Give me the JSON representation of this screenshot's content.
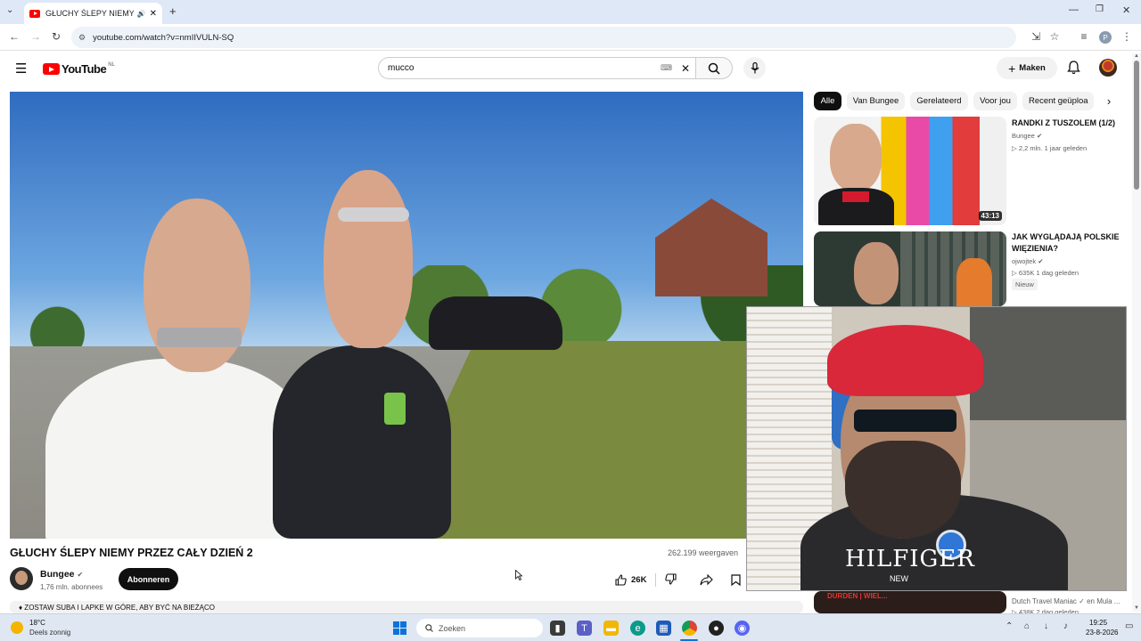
{
  "browser": {
    "tab_title": "GŁUCHY ŚLEPY NIEMY PRZEZ...",
    "url": "youtube.com/watch?v=nmIIVULN-SQ",
    "profile_initial": "P"
  },
  "masthead": {
    "logo": "YouTube",
    "region": "NL",
    "search_value": "mucco",
    "create_label": "Maken"
  },
  "video": {
    "title": "GŁUCHY ŚLEPY NIEMY PRZEZ CAŁY DZIEŃ 2",
    "views": "262.199 weergaven",
    "channel": "Bungee",
    "subscribers": "1,76 mln. abonnees",
    "subscribe_label": "Abonneren",
    "likes": "26K",
    "description_preview": "♦ ZOSTAW SUBA I LAPKE W GÓRE, ABY BYĆ NA BIEŻĄCO"
  },
  "webcam": {
    "shirt_text": "HILFIGER",
    "shirt_sub": "NEW"
  },
  "sidebar": {
    "chips": [
      "Alle",
      "Van Bungee",
      "Gerelateerd",
      "Voor jou",
      "Recent geüploa"
    ],
    "items": [
      {
        "title": "RANDKI Z TUSZOLEM (1/2)",
        "channel": "Bungee",
        "meta": "▷ 2,2 mln.   1 jaar geleden",
        "duration": "43:13"
      },
      {
        "title": "JAK WYGLĄDAJĄ POLSKIE WIĘZIENIA?",
        "channel": "ojwojtek",
        "meta": "▷ 635K   1 dag geleden",
        "badge": "Nieuw"
      },
      {
        "channel": "Dutch Travel Maniac ✓ en Mula ...",
        "meta": "▷ 438K   2 dag geleden",
        "thumb_text": "DURDEN | WIEL..."
      }
    ]
  },
  "taskbar": {
    "temp": "18°C",
    "weather": "Deels zonnig",
    "search_placeholder": "Zoeken",
    "time": "19:25",
    "date": "23-8-2026"
  },
  "colors": {
    "yt_red": "#ff0000",
    "chip_active": "#0f0f0f",
    "subscribe_bg": "#0f0f0f"
  }
}
